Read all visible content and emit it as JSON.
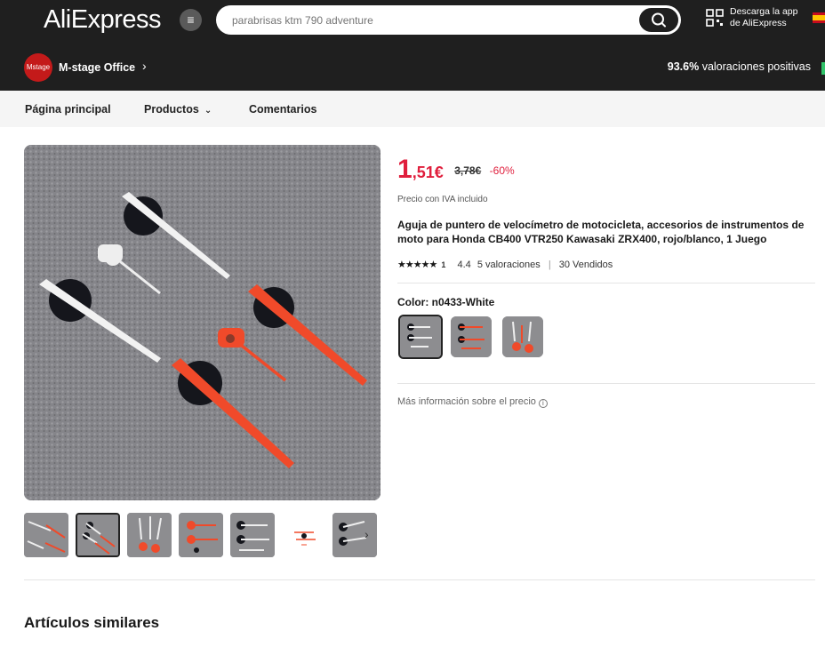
{
  "header": {
    "logo": "AliExpress",
    "search_placeholder": "parabrisas ktm 790 adventure",
    "app_download_line1": "Descarga la app",
    "app_download_line2": "de AliExpress"
  },
  "store": {
    "logo_text": "Mstage",
    "name": "M-stage Office",
    "rating_value": "93.6%",
    "rating_label": " valoraciones positivas"
  },
  "nav": {
    "home": "Página principal",
    "products": "Productos",
    "reviews": "Comentarios"
  },
  "product": {
    "price_int": "1",
    "price_dec": ",51€",
    "original_price": "3,78€",
    "discount": "-60%",
    "vat_note": "Precio con IVA incluido",
    "title": "Aguja de puntero de velocímetro de motocicleta, accesorios de instrumentos de moto para Honda CB400 VTR250 Kawasaki ZRX400, rojo/blanco, 1 Juego",
    "stars_display": "★★★★★",
    "stars_small": "1",
    "rating": "4.4",
    "reviews": "5 valoraciones",
    "sold": "30 Vendidos",
    "color_label": "Color: n0433-White",
    "more_info": "Más información sobre el precio"
  },
  "colors": {
    "accent_red": "#e01f3d",
    "header_bg": "#1f1f1f",
    "needle_red": "#f04a2a",
    "needle_white": "#f2f2f2"
  },
  "similar_title": "Artículos similares"
}
